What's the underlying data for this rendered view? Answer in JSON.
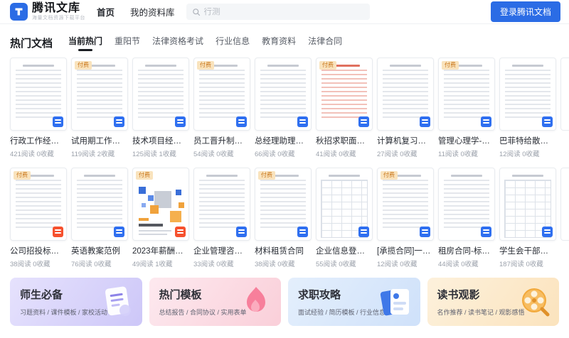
{
  "header": {
    "logo_title": "腾讯文库",
    "logo_tagline": "海量文档资源下载平台",
    "nav_items": [
      {
        "label": "首页",
        "active": true
      },
      {
        "label": "我的资料库",
        "active": false
      }
    ],
    "search": {
      "placeholder": "行测"
    },
    "login_button_label": "登录腾讯文档"
  },
  "hot_docs": {
    "title": "热门文档",
    "tabs": [
      {
        "label": "当前热门",
        "active": true
      },
      {
        "label": "重阳节",
        "active": false
      },
      {
        "label": "法律资格考试",
        "active": false
      },
      {
        "label": "行业信息",
        "active": false
      },
      {
        "label": "教育资料",
        "active": false
      },
      {
        "label": "法律合同",
        "active": false
      }
    ],
    "paid_tag_label": "付费",
    "rows": [
      [
        {
          "title": "行政工作经验分...",
          "stats": "421阅读 0收藏",
          "paid": false,
          "file_icon": "doc",
          "thumb": "lines"
        },
        {
          "title": "试用期工作经验...",
          "stats": "119阅读 2收藏",
          "paid": true,
          "file_icon": "doc",
          "thumb": "lines"
        },
        {
          "title": "技术项目经理面...",
          "stats": "125阅读 1收藏",
          "paid": false,
          "file_icon": "doc",
          "thumb": "lines"
        },
        {
          "title": "员工晋升制度及...",
          "stats": "54阅读 0收藏",
          "paid": true,
          "file_icon": "doc",
          "thumb": "lines"
        },
        {
          "title": "总经理助理工作...",
          "stats": "66阅读 0收藏",
          "paid": false,
          "file_icon": "doc",
          "thumb": "lines"
        },
        {
          "title": "秋招求职面试技巧",
          "stats": "41阅读 0收藏",
          "paid": true,
          "file_icon": "doc",
          "thumb": "red-lines"
        },
        {
          "title": "计算机复习资料",
          "stats": "27阅读 0收藏",
          "paid": false,
          "file_icon": "doc",
          "thumb": "lines"
        },
        {
          "title": "管理心理学-复习...",
          "stats": "11阅读 0收藏",
          "paid": true,
          "file_icon": "doc",
          "thumb": "lines"
        },
        {
          "title": "巴菲特给散户的9...",
          "stats": "12阅读 0收藏",
          "paid": false,
          "file_icon": "doc",
          "thumb": "lines"
        }
      ],
      [
        {
          "title": "公司招投标授权...",
          "stats": "38阅读 0收藏",
          "paid": true,
          "file_icon": "pdf",
          "thumb": "lines"
        },
        {
          "title": "英语教案范例",
          "stats": "76阅读 0收藏",
          "paid": false,
          "file_icon": "doc",
          "thumb": "lines"
        },
        {
          "title": "2023年薪酬报告...",
          "stats": "49阅读 1收藏",
          "paid": true,
          "file_icon": "pdf",
          "thumb": "cover"
        },
        {
          "title": "企业管理咨询合同",
          "stats": "33阅读 0收藏",
          "paid": false,
          "file_icon": "doc",
          "thumb": "lines"
        },
        {
          "title": "材料租赁合同",
          "stats": "38阅读 0收藏",
          "paid": true,
          "file_icon": "doc",
          "thumb": "lines"
        },
        {
          "title": "企业信息登记表",
          "stats": "55阅读 0收藏",
          "paid": false,
          "file_icon": "doc",
          "thumb": "table"
        },
        {
          "title": "[承揽合同]一加...",
          "stats": "12阅读 0收藏",
          "paid": true,
          "file_icon": "doc",
          "thumb": "lines"
        },
        {
          "title": "租房合同-标准版",
          "stats": "44阅读 0收藏",
          "paid": false,
          "file_icon": "doc",
          "thumb": "lines"
        },
        {
          "title": "学生会干部竞选...",
          "stats": "187阅读 0收藏",
          "paid": false,
          "file_icon": "doc",
          "thumb": "table"
        }
      ]
    ]
  },
  "promo_banners": [
    {
      "title": "师生必备",
      "subtitle": "习题资料 / 课件模板 / 家校活动",
      "icon": "document-icon",
      "theme": "purple"
    },
    {
      "title": "热门模板",
      "subtitle": "总结报告 / 合同协议 / 实用表单",
      "icon": "flame-icon",
      "theme": "pink"
    },
    {
      "title": "求职攻略",
      "subtitle": "面试经验 / 简历模板 / 行业信息",
      "icon": "resume-icon",
      "theme": "blue"
    },
    {
      "title": "读书观影",
      "subtitle": "名作推荐 / 读书笔记 / 观影感悟",
      "icon": "film-reel-icon",
      "theme": "orange"
    }
  ],
  "colors": {
    "accent_blue": "#2B6CE5",
    "doc_icon_blue": "#2F6FF0",
    "pdf_icon_red": "#F6512E",
    "paid_tag_bg": "#F9E3BD",
    "paid_tag_text": "#C9761B"
  }
}
